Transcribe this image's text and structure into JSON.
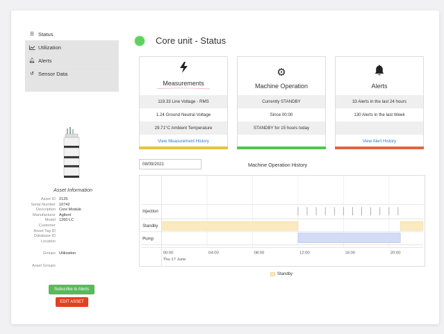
{
  "nav": {
    "items": [
      {
        "label": "Status",
        "icon": "list-icon"
      },
      {
        "label": "Utilization",
        "icon": "line-chart-icon"
      },
      {
        "label": "Alerts",
        "icon": "bell-icon"
      },
      {
        "label": "Sensor Data",
        "icon": "history-icon"
      }
    ]
  },
  "asset": {
    "title": "Asset Information",
    "fields": [
      {
        "k": "Asset ID",
        "v": "2125"
      },
      {
        "k": "Serial Number",
        "v": "10742"
      },
      {
        "k": "Description",
        "v": "Core Module"
      },
      {
        "k": "Manufacturer",
        "v": "Agilent"
      },
      {
        "k": "Model",
        "v": "1260 LC"
      },
      {
        "k": "Customer",
        "v": ""
      },
      {
        "k": "Asset Tag ID",
        "v": ""
      },
      {
        "k": "Database ID",
        "v": ""
      },
      {
        "k": "Location",
        "v": ""
      }
    ],
    "groups_label": "Groups",
    "groups_value": "Utilization",
    "asset_groups_label": "Asset Groups",
    "asset_groups_value": "",
    "subscribe_label": "Subscribe to Alerts",
    "edit_label": "EDIT ASSET"
  },
  "header": {
    "title": "Core unit - Status",
    "status_color": "#5fd15f"
  },
  "cards": [
    {
      "title": "Measurements",
      "icon": "bolt-icon",
      "rows": [
        "119.33 Line Voltage - RMS",
        "1.24 Ground Neutral Voltage",
        "29.71°C Ambient Temperature"
      ],
      "link": "View Measurement History",
      "bar_color": "#e6c23e"
    },
    {
      "title": "Machine Operation",
      "icon": "gear-icon",
      "rows": [
        "Currently STANDBY",
        "Since 00:00",
        "STANDBY for 15 hours today"
      ],
      "link": "",
      "bar_color": "#4cc84c"
    },
    {
      "title": "Alerts",
      "icon": "bell-icon",
      "rows": [
        "33 Alerts in the last 24 hours",
        "130 Alerts in the last Week",
        ""
      ],
      "link": "View Alert History",
      "bar_color": "#e2643f"
    }
  ],
  "history": {
    "date": "08/09/2021",
    "title": "Machine Operation History"
  },
  "chart_data": {
    "type": "timeline",
    "rows": [
      "Injection",
      "Standby",
      "Pump"
    ],
    "x_ticks": [
      "00:00",
      "04:00",
      "08:00",
      "12:00",
      "16:00",
      "20:00"
    ],
    "x_sublabel": "Thu 17 June",
    "x_range_hours": [
      0,
      23
    ],
    "injection_times_hours": [
      12.0,
      12.8,
      13.6,
      14.4,
      15.2,
      16.0,
      16.8,
      17.6,
      18.4,
      19.2,
      20.0,
      20.8
    ],
    "standby_intervals_hours": [
      [
        0,
        12.0
      ],
      [
        21.0,
        23
      ]
    ],
    "pump_intervals_hours": [
      [
        12.0,
        21.0
      ]
    ],
    "standby_color": "#fbe9c0",
    "pump_color": "#d3dcf6",
    "legend": [
      "Standby"
    ]
  }
}
